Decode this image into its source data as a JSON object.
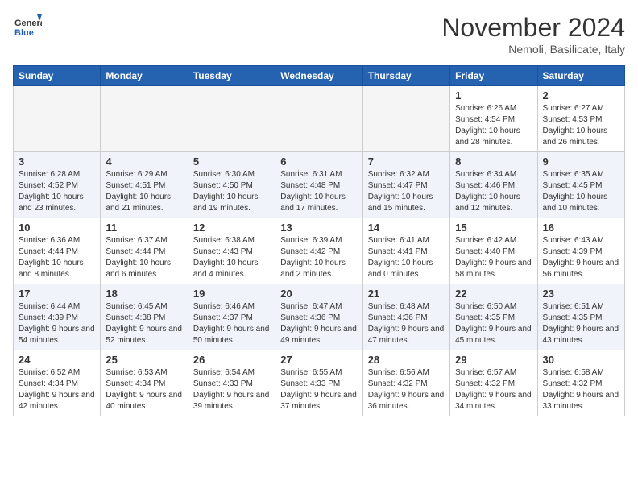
{
  "header": {
    "logo_general": "General",
    "logo_blue": "Blue",
    "month_title": "November 2024",
    "location": "Nemoli, Basilicate, Italy"
  },
  "days_of_week": [
    "Sunday",
    "Monday",
    "Tuesday",
    "Wednesday",
    "Thursday",
    "Friday",
    "Saturday"
  ],
  "weeks": [
    [
      {
        "day": "",
        "detail": ""
      },
      {
        "day": "",
        "detail": ""
      },
      {
        "day": "",
        "detail": ""
      },
      {
        "day": "",
        "detail": ""
      },
      {
        "day": "",
        "detail": ""
      },
      {
        "day": "1",
        "detail": "Sunrise: 6:26 AM\nSunset: 4:54 PM\nDaylight: 10 hours and 28 minutes."
      },
      {
        "day": "2",
        "detail": "Sunrise: 6:27 AM\nSunset: 4:53 PM\nDaylight: 10 hours and 26 minutes."
      }
    ],
    [
      {
        "day": "3",
        "detail": "Sunrise: 6:28 AM\nSunset: 4:52 PM\nDaylight: 10 hours and 23 minutes."
      },
      {
        "day": "4",
        "detail": "Sunrise: 6:29 AM\nSunset: 4:51 PM\nDaylight: 10 hours and 21 minutes."
      },
      {
        "day": "5",
        "detail": "Sunrise: 6:30 AM\nSunset: 4:50 PM\nDaylight: 10 hours and 19 minutes."
      },
      {
        "day": "6",
        "detail": "Sunrise: 6:31 AM\nSunset: 4:48 PM\nDaylight: 10 hours and 17 minutes."
      },
      {
        "day": "7",
        "detail": "Sunrise: 6:32 AM\nSunset: 4:47 PM\nDaylight: 10 hours and 15 minutes."
      },
      {
        "day": "8",
        "detail": "Sunrise: 6:34 AM\nSunset: 4:46 PM\nDaylight: 10 hours and 12 minutes."
      },
      {
        "day": "9",
        "detail": "Sunrise: 6:35 AM\nSunset: 4:45 PM\nDaylight: 10 hours and 10 minutes."
      }
    ],
    [
      {
        "day": "10",
        "detail": "Sunrise: 6:36 AM\nSunset: 4:44 PM\nDaylight: 10 hours and 8 minutes."
      },
      {
        "day": "11",
        "detail": "Sunrise: 6:37 AM\nSunset: 4:44 PM\nDaylight: 10 hours and 6 minutes."
      },
      {
        "day": "12",
        "detail": "Sunrise: 6:38 AM\nSunset: 4:43 PM\nDaylight: 10 hours and 4 minutes."
      },
      {
        "day": "13",
        "detail": "Sunrise: 6:39 AM\nSunset: 4:42 PM\nDaylight: 10 hours and 2 minutes."
      },
      {
        "day": "14",
        "detail": "Sunrise: 6:41 AM\nSunset: 4:41 PM\nDaylight: 10 hours and 0 minutes."
      },
      {
        "day": "15",
        "detail": "Sunrise: 6:42 AM\nSunset: 4:40 PM\nDaylight: 9 hours and 58 minutes."
      },
      {
        "day": "16",
        "detail": "Sunrise: 6:43 AM\nSunset: 4:39 PM\nDaylight: 9 hours and 56 minutes."
      }
    ],
    [
      {
        "day": "17",
        "detail": "Sunrise: 6:44 AM\nSunset: 4:39 PM\nDaylight: 9 hours and 54 minutes."
      },
      {
        "day": "18",
        "detail": "Sunrise: 6:45 AM\nSunset: 4:38 PM\nDaylight: 9 hours and 52 minutes."
      },
      {
        "day": "19",
        "detail": "Sunrise: 6:46 AM\nSunset: 4:37 PM\nDaylight: 9 hours and 50 minutes."
      },
      {
        "day": "20",
        "detail": "Sunrise: 6:47 AM\nSunset: 4:36 PM\nDaylight: 9 hours and 49 minutes."
      },
      {
        "day": "21",
        "detail": "Sunrise: 6:48 AM\nSunset: 4:36 PM\nDaylight: 9 hours and 47 minutes."
      },
      {
        "day": "22",
        "detail": "Sunrise: 6:50 AM\nSunset: 4:35 PM\nDaylight: 9 hours and 45 minutes."
      },
      {
        "day": "23",
        "detail": "Sunrise: 6:51 AM\nSunset: 4:35 PM\nDaylight: 9 hours and 43 minutes."
      }
    ],
    [
      {
        "day": "24",
        "detail": "Sunrise: 6:52 AM\nSunset: 4:34 PM\nDaylight: 9 hours and 42 minutes."
      },
      {
        "day": "25",
        "detail": "Sunrise: 6:53 AM\nSunset: 4:34 PM\nDaylight: 9 hours and 40 minutes."
      },
      {
        "day": "26",
        "detail": "Sunrise: 6:54 AM\nSunset: 4:33 PM\nDaylight: 9 hours and 39 minutes."
      },
      {
        "day": "27",
        "detail": "Sunrise: 6:55 AM\nSunset: 4:33 PM\nDaylight: 9 hours and 37 minutes."
      },
      {
        "day": "28",
        "detail": "Sunrise: 6:56 AM\nSunset: 4:32 PM\nDaylight: 9 hours and 36 minutes."
      },
      {
        "day": "29",
        "detail": "Sunrise: 6:57 AM\nSunset: 4:32 PM\nDaylight: 9 hours and 34 minutes."
      },
      {
        "day": "30",
        "detail": "Sunrise: 6:58 AM\nSunset: 4:32 PM\nDaylight: 9 hours and 33 minutes."
      }
    ]
  ]
}
